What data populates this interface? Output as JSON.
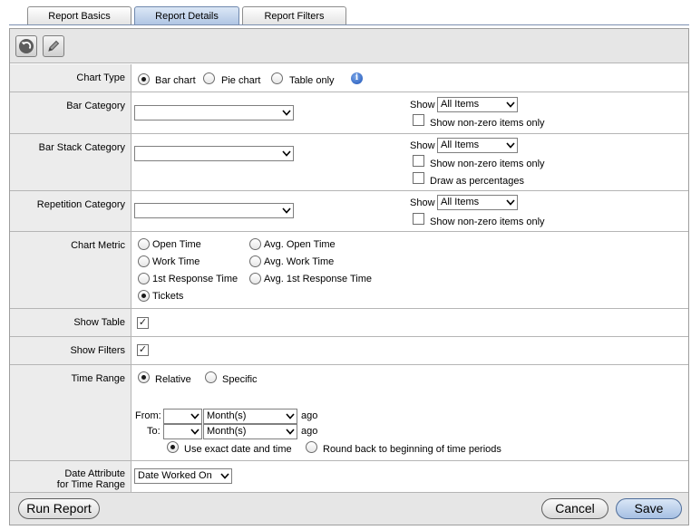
{
  "tabs": [
    "Report Basics",
    "Report Details",
    "Report Filters"
  ],
  "toolbar": {
    "undo_icon": "undo-icon",
    "edit_icon": "pencil-icon"
  },
  "chart_type": {
    "label": "Chart Type",
    "options": [
      "Bar chart",
      "Pie chart",
      "Table only"
    ],
    "selected": "Bar chart"
  },
  "bar_category": {
    "label": "Bar Category",
    "value": "",
    "show_label": "Show",
    "show_value": "All Items",
    "nonzero_label": "Show non-zero items only"
  },
  "bar_stack_category": {
    "label": "Bar Stack Category",
    "value": "",
    "show_label": "Show",
    "show_value": "All Items",
    "nonzero_label": "Show non-zero items only",
    "percent_label": "Draw as percentages"
  },
  "repetition_category": {
    "label": "Repetition Category",
    "value": "",
    "show_label": "Show",
    "show_value": "All Items",
    "nonzero_label": "Show non-zero items only"
  },
  "chart_metric": {
    "label": "Chart Metric",
    "options": [
      "Open Time",
      "Avg. Open Time",
      "Work Time",
      "Avg. Work Time",
      "1st Response Time",
      "Avg. 1st Response Time",
      "Tickets"
    ],
    "selected": "Tickets"
  },
  "show_table": {
    "label": "Show Table",
    "checked": true
  },
  "show_filters": {
    "label": "Show Filters",
    "checked": true
  },
  "time_range": {
    "label": "Time Range",
    "relative_label": "Relative",
    "specific_label": "Specific",
    "selected": "Relative",
    "from_label": "From:",
    "to_label": "To:",
    "from_number": "",
    "from_unit": "Month(s)",
    "to_number": "",
    "to_unit": "Month(s)",
    "ago_label": "ago",
    "exact_label": "Use exact date and time",
    "round_label": "Round back to beginning of time periods",
    "rounding_selected": "Use exact date and time"
  },
  "date_attribute": {
    "label_line1": "Date Attribute",
    "label_line2": "for Time Range",
    "value": "Date Worked On"
  },
  "footer": {
    "run_label": "Run Report",
    "cancel_label": "Cancel",
    "save_label": "Save"
  },
  "check_mark": "✓"
}
